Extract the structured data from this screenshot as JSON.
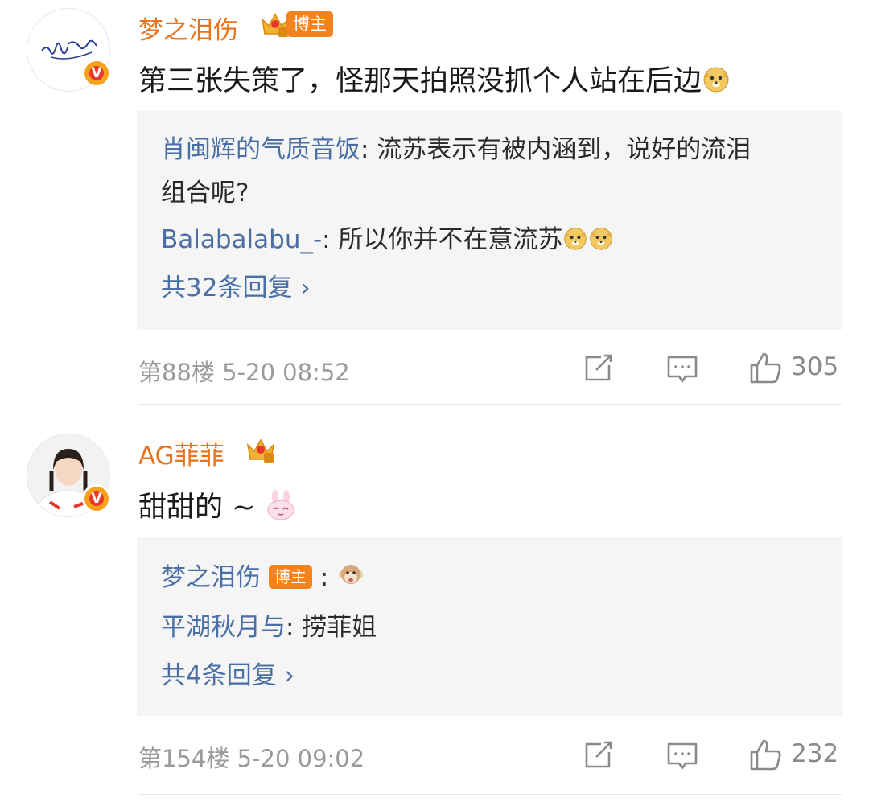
{
  "comments": [
    {
      "author": "梦之泪伤",
      "author_tag": "博主",
      "text": "第三张失策了，怪那天拍照没抓个人站在后边",
      "replies": [
        {
          "name": "肖闽辉的气质音饭",
          "text": ": 流苏表示有被内涵到，说好的流泪",
          "text2": "组合呢?"
        },
        {
          "name": "Balabalabu_-",
          "text": ": 所以你并不在意流苏"
        }
      ],
      "reply_count": "共32条回复 ›",
      "floor": "第88楼",
      "time": "5-20 08:52",
      "likes": "305"
    },
    {
      "author": "AG菲菲",
      "text": "甜甜的 ~",
      "replies": [
        {
          "name": "梦之泪伤",
          "tag": "博主",
          "text": " :"
        },
        {
          "name": "平湖秋月与",
          "text": ": 捞菲姐"
        }
      ],
      "reply_count": "共4条回复 ›",
      "floor": "第154楼",
      "time": "5-20 09:02",
      "likes": "232"
    }
  ],
  "colors": {
    "author": "#e8731c",
    "reply_name": "#4a6fa5",
    "tag_bg": "#f4821f",
    "verified": "#f7a21b"
  },
  "icons": [
    "verified-badge-icon",
    "crown-icon",
    "doge-emoji-icon",
    "rabbit-emoji-icon",
    "monkey-emoji-icon",
    "repost-icon",
    "comment-icon",
    "like-icon"
  ]
}
